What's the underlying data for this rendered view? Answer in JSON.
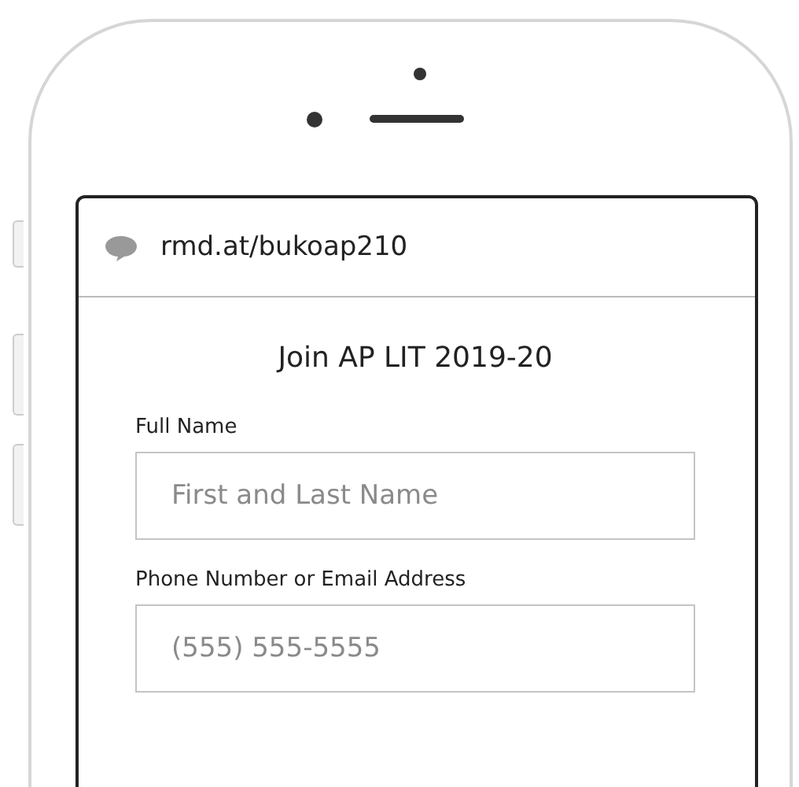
{
  "browser": {
    "url": "rmd.at/bukoap210"
  },
  "form": {
    "title": "Join AP LIT 2019-20",
    "fields": [
      {
        "label": "Full Name",
        "placeholder": "First and Last Name"
      },
      {
        "label": "Phone Number or Email Address",
        "placeholder": "(555) 555-5555"
      }
    ]
  }
}
